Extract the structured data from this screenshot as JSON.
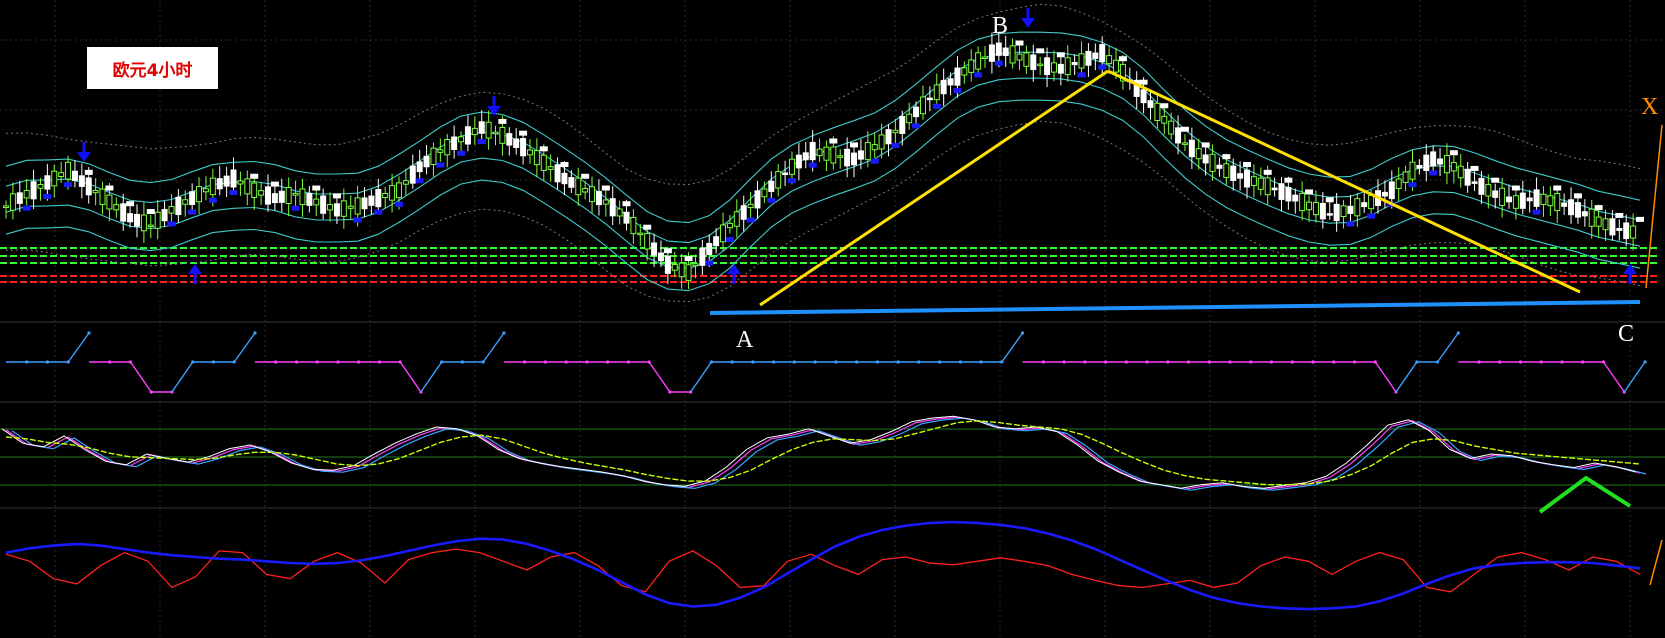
{
  "title_label": "欧元4小时",
  "points": {
    "A": "A",
    "B": "B",
    "C": "C",
    "X": "X"
  },
  "colors": {
    "background": "#000000",
    "bull_candle": "#7dff3a",
    "bear_candle": "#ffffff",
    "support_line": "#1e90ff",
    "trend_line": "#ffe000",
    "arrow": "#1010ff",
    "upper_dots": "#ffffff",
    "lower_dots": "#1a1aff",
    "zigzag_up": "#3aa0ff",
    "zigzag_down": "#ff40ff",
    "osc_signal": "#c8ff00",
    "macd_slow": "#1a1aff",
    "macd_fast": "#ff2020",
    "green_peak": "#20e020",
    "hline_green": "#33ff33",
    "hline_red": "#ff2020"
  },
  "chart_data": [
    {
      "type": "candlestick",
      "panel": "price",
      "series": [
        {
          "name": "price",
          "values": [
            1.342,
            1.345,
            1.348,
            1.351,
            1.347,
            1.343,
            1.339,
            1.337,
            1.341,
            1.344,
            1.347,
            1.349,
            1.346,
            1.344,
            1.345,
            1.343,
            1.341,
            1.342,
            1.344,
            1.346,
            1.352,
            1.356,
            1.359,
            1.362,
            1.36,
            1.357,
            1.353,
            1.349,
            1.346,
            1.343,
            1.339,
            1.333,
            1.327,
            1.325,
            1.331,
            1.337,
            1.342,
            1.347,
            1.352,
            1.356,
            1.355,
            1.354,
            1.357,
            1.361,
            1.366,
            1.371,
            1.375,
            1.379,
            1.382,
            1.38,
            1.378,
            1.377,
            1.379,
            1.381,
            1.376,
            1.37,
            1.364,
            1.358,
            1.354,
            1.351,
            1.349,
            1.347,
            1.345,
            1.342,
            1.34,
            1.341,
            1.343,
            1.346,
            1.351,
            1.354,
            1.352,
            1.348,
            1.345,
            1.343,
            1.344,
            1.343,
            1.341,
            1.338,
            1.336,
            1.335
          ]
        }
      ],
      "pattern_points": [
        "A",
        "B",
        "C"
      ]
    },
    {
      "type": "line",
      "panel": "zigzag-indicator",
      "series": [
        {
          "name": "zigzag",
          "values": [
            0,
            0,
            0,
            0,
            1,
            1,
            1,
            -1,
            -1,
            0,
            0,
            0,
            1,
            1,
            1,
            1,
            1,
            1,
            1,
            1,
            -1,
            0,
            0,
            0,
            1,
            1,
            1,
            1,
            1,
            1,
            1,
            1,
            -1,
            -1,
            0,
            0,
            0,
            0,
            0,
            0,
            0,
            0,
            0,
            0,
            0,
            0,
            0,
            0,
            0,
            1,
            1,
            1,
            1,
            1,
            1,
            1,
            1,
            1,
            1,
            1,
            1,
            1,
            1,
            1,
            1,
            1,
            1,
            -1,
            0,
            0,
            1,
            1,
            1,
            1,
            1,
            1,
            1,
            1,
            -1,
            0
          ]
        }
      ]
    },
    {
      "type": "line",
      "panel": "stochastic",
      "series": [
        {
          "name": "fast",
          "values": [
            78,
            62,
            58,
            70,
            55,
            42,
            38,
            50,
            45,
            41,
            47,
            56,
            60,
            52,
            40,
            33,
            32,
            37,
            50,
            62,
            72,
            80,
            78,
            70,
            55,
            45,
            40,
            36,
            33,
            30,
            26,
            20,
            16,
            14,
            20,
            35,
            55,
            68,
            72,
            78,
            70,
            62,
            66,
            75,
            86,
            90,
            92,
            88,
            80,
            78,
            80,
            75,
            60,
            42,
            30,
            20,
            16,
            12,
            16,
            18,
            14,
            12,
            15,
            18,
            25,
            40,
            60,
            82,
            88,
            76,
            55,
            45,
            50,
            48,
            42,
            38,
            35,
            40,
            36,
            30
          ]
        },
        {
          "name": "slow",
          "values": [
            70,
            68,
            64,
            62,
            58,
            52,
            48,
            47,
            46,
            45,
            46,
            50,
            53,
            53,
            50,
            45,
            40,
            38,
            40,
            46,
            55,
            64,
            70,
            72,
            68,
            60,
            52,
            46,
            41,
            37,
            33,
            28,
            24,
            21,
            21,
            25,
            33,
            45,
            56,
            64,
            68,
            67,
            66,
            68,
            74,
            80,
            86,
            88,
            86,
            83,
            81,
            79,
            73,
            63,
            52,
            42,
            33,
            27,
            23,
            21,
            19,
            17,
            17,
            18,
            21,
            28,
            38,
            52,
            64,
            68,
            66,
            60,
            56,
            52,
            50,
            48,
            46,
            44,
            42,
            40
          ]
        }
      ]
    },
    {
      "type": "line",
      "panel": "macd",
      "series": [
        {
          "name": "slow",
          "values": [
            0.2,
            0.25,
            0.28,
            0.3,
            0.28,
            0.24,
            0.2,
            0.17,
            0.15,
            0.13,
            0.12,
            0.1,
            0.08,
            0.07,
            0.08,
            0.11,
            0.16,
            0.22,
            0.28,
            0.33,
            0.36,
            0.35,
            0.3,
            0.22,
            0.12,
            0.0,
            -0.14,
            -0.28,
            -0.38,
            -0.42,
            -0.4,
            -0.32,
            -0.2,
            -0.04,
            0.12,
            0.27,
            0.38,
            0.46,
            0.51,
            0.54,
            0.55,
            0.54,
            0.52,
            0.48,
            0.42,
            0.34,
            0.24,
            0.12,
            0.0,
            -0.12,
            -0.23,
            -0.32,
            -0.38,
            -0.42,
            -0.44,
            -0.45,
            -0.44,
            -0.42,
            -0.36,
            -0.27,
            -0.16,
            -0.06,
            0.02,
            0.06,
            0.08,
            0.09,
            0.09,
            0.08,
            0.05,
            0.02
          ]
        },
        {
          "name": "fast",
          "values": [
            0.18,
            0.1,
            -0.1,
            -0.16,
            0.05,
            0.2,
            0.1,
            -0.2,
            -0.08,
            0.22,
            0.2,
            -0.05,
            -0.1,
            0.1,
            0.2,
            0.08,
            -0.15,
            0.12,
            0.2,
            0.24,
            0.2,
            0.1,
            0.0,
            0.15,
            0.2,
            0.05,
            -0.18,
            -0.25,
            0.1,
            0.22,
            0.05,
            -0.2,
            -0.18,
            0.1,
            0.18,
            0.05,
            -0.05,
            0.12,
            0.15,
            0.08,
            0.06,
            0.1,
            0.14,
            0.1,
            0.05,
            -0.05,
            -0.12,
            -0.18,
            -0.2,
            -0.16,
            -0.12,
            -0.2,
            -0.15,
            0.05,
            0.15,
            0.1,
            -0.05,
            0.1,
            0.2,
            0.12,
            -0.2,
            -0.25,
            -0.05,
            0.15,
            0.2,
            0.12,
            0.0,
            0.15,
            0.1,
            -0.05
          ]
        }
      ]
    }
  ]
}
